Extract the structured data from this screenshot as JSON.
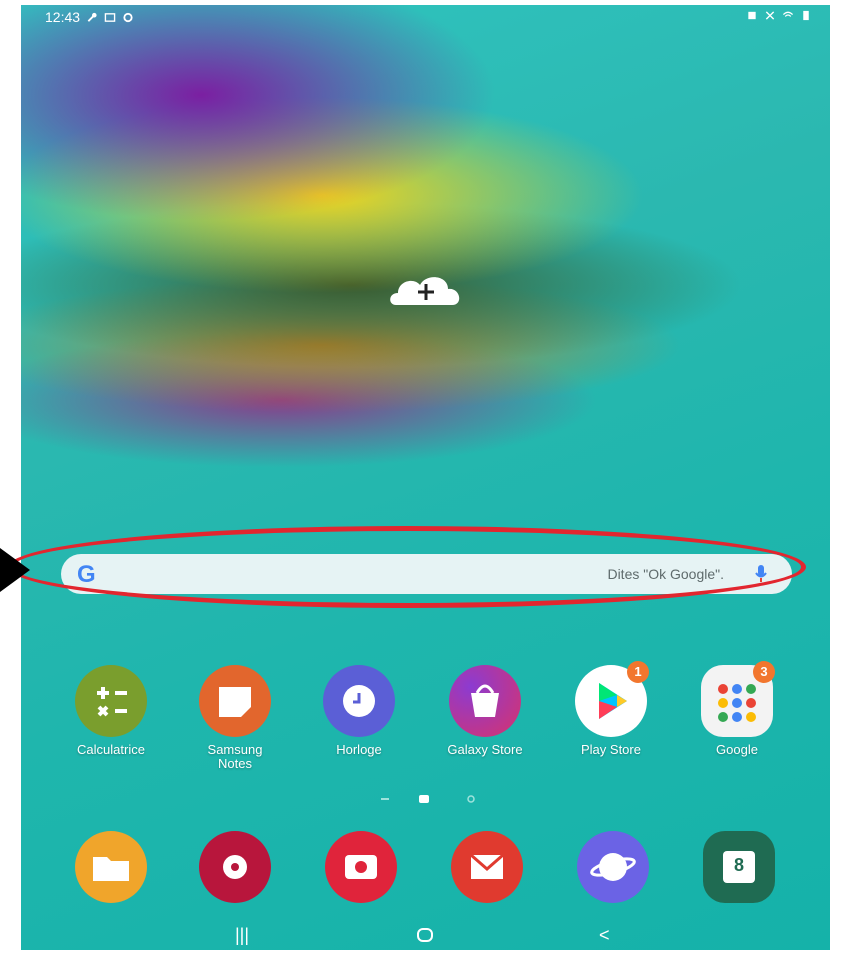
{
  "status_bar": {
    "time": "12:43",
    "left_icons": [
      "wrench-icon",
      "gallery-icon",
      "settings-icon"
    ],
    "right_icons": [
      "alarm-icon",
      "mute-icon",
      "wifi-icon",
      "battery-icon"
    ]
  },
  "search": {
    "hint": "Dites \"Ok Google\".",
    "logo": "G"
  },
  "apps": [
    {
      "label": "Calculatrice",
      "color": "#7a9e2d",
      "badge": ""
    },
    {
      "label": "Samsung\nNotes",
      "color": "#e2662d",
      "badge": ""
    },
    {
      "label": "Horloge",
      "color": "#5b5fd6",
      "badge": ""
    },
    {
      "label": "Galaxy Store",
      "color": "#c23b8e",
      "badge": ""
    },
    {
      "label": "Play Store",
      "color": "#ffffff",
      "badge": "1"
    },
    {
      "label": "Google",
      "color": "#f3f3f3",
      "badge": "3"
    }
  ],
  "dock": [
    {
      "name": "my-files",
      "color": "#f0a52b"
    },
    {
      "name": "gallery",
      "color": "#b8163c"
    },
    {
      "name": "camera",
      "color": "#e0243b"
    },
    {
      "name": "email",
      "color": "#e03a2f"
    },
    {
      "name": "internet",
      "color": "#6b63e5"
    },
    {
      "name": "calendar",
      "color": "#1f6b52",
      "text": "8"
    }
  ]
}
